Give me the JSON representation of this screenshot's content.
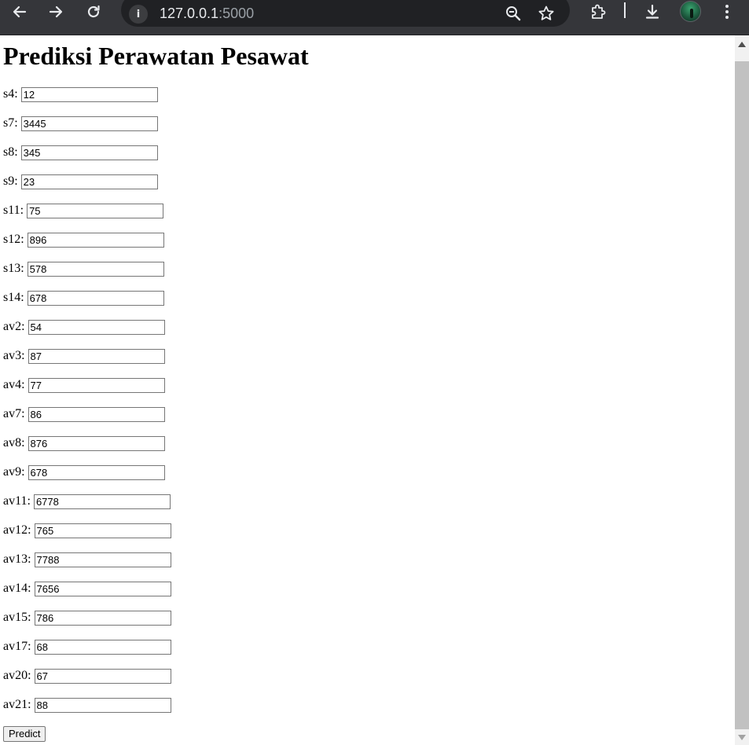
{
  "browser": {
    "url_host": "127.0.0.1",
    "url_port": ":5000",
    "site_info_glyph": "i",
    "icons": [
      "back-arrow-icon",
      "forward-arrow-icon",
      "reload-icon",
      "site-info-icon",
      "zoom-out-icon",
      "bookmark-star-icon",
      "extensions-icon",
      "download-icon",
      "profile-avatar",
      "menu-kebab-icon"
    ],
    "colors": {
      "toolbar": "#35363a",
      "omnibox": "#202124",
      "icon": "#e8eaed",
      "port_text": "#9aa0a6"
    }
  },
  "page": {
    "title": "Prediksi Perawatan Pesawat",
    "fields": [
      {
        "label": "s4:",
        "value": "12"
      },
      {
        "label": "s7:",
        "value": "3445"
      },
      {
        "label": "s8:",
        "value": "345"
      },
      {
        "label": "s9:",
        "value": "23"
      },
      {
        "label": "s11:",
        "value": "75"
      },
      {
        "label": "s12:",
        "value": "896"
      },
      {
        "label": "s13:",
        "value": "578"
      },
      {
        "label": "s14:",
        "value": "678"
      },
      {
        "label": "av2:",
        "value": "54"
      },
      {
        "label": "av3:",
        "value": "87"
      },
      {
        "label": "av4:",
        "value": "77"
      },
      {
        "label": "av7:",
        "value": "86"
      },
      {
        "label": "av8:",
        "value": "876"
      },
      {
        "label": "av9:",
        "value": "678"
      },
      {
        "label": "av11:",
        "value": "6778"
      },
      {
        "label": "av12:",
        "value": "765"
      },
      {
        "label": "av13:",
        "value": "7788"
      },
      {
        "label": "av14:",
        "value": "7656"
      },
      {
        "label": "av15:",
        "value": "786"
      },
      {
        "label": "av17:",
        "value": "68"
      },
      {
        "label": "av20:",
        "value": "67"
      },
      {
        "label": "av21:",
        "value": "88"
      }
    ],
    "submit_label": "Predict"
  }
}
